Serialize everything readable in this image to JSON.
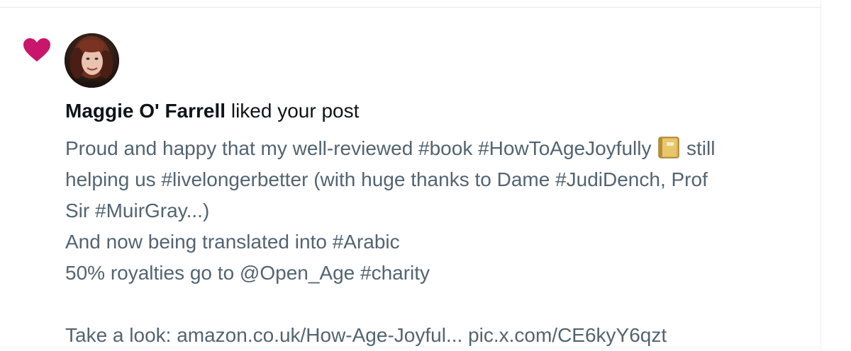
{
  "notification": {
    "type_icon": "heart-icon",
    "accent_color": "#c8176b",
    "avatar_icon": "avatar-photo",
    "user_name": "Maggie O' Farrell",
    "action_text": " liked your post"
  },
  "post": {
    "line1_before": "Proud and happy that my well-reviewed #book #HowToAgeJoyfully ",
    "line1_emoji": "book-emoji-icon",
    "line1_after": " still",
    "line2": "helping us #livelongerbetter (with huge thanks to Dame #JudiDench, Prof",
    "line3": "Sir #MuirGray...)",
    "line4": "And now being translated into #Arabic",
    "line5": "50% royalties go to @Open_Age #charity",
    "line6": "Take a look: amazon.co.uk/How-Age-Joyful... pic.x.com/CE6kyY6qzt"
  }
}
